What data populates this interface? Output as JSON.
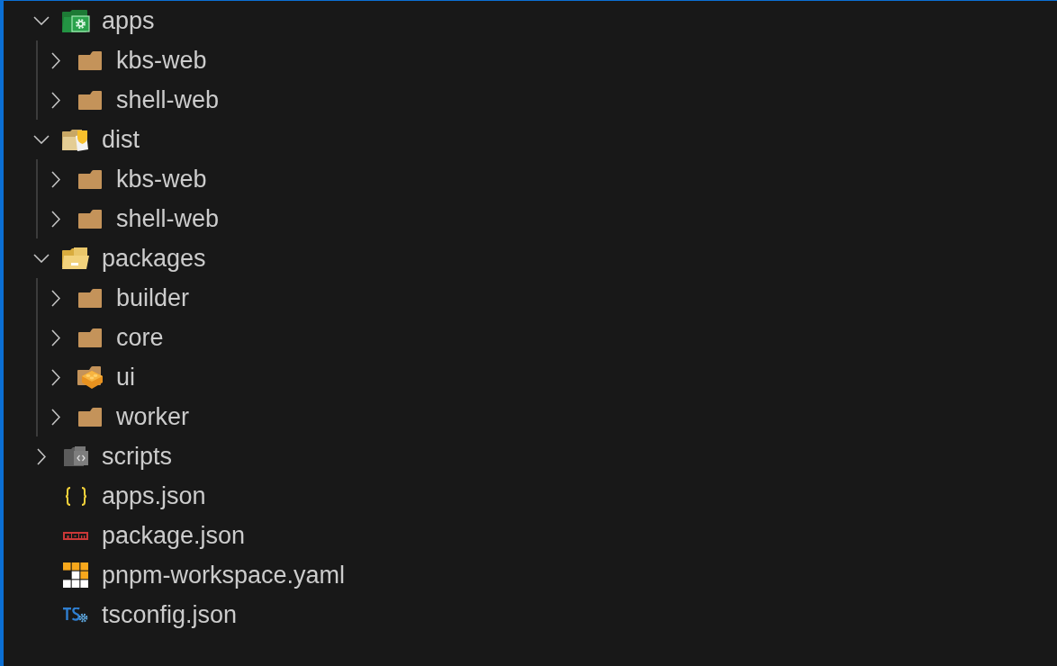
{
  "explorer": {
    "items": [
      {
        "name": "apps",
        "kind": "apps-folder",
        "expanded": true,
        "children": [
          {
            "name": "kbs-web",
            "kind": "folder",
            "expanded": false
          },
          {
            "name": "shell-web",
            "kind": "folder",
            "expanded": false
          }
        ]
      },
      {
        "name": "dist",
        "kind": "dist-folder",
        "expanded": true,
        "children": [
          {
            "name": "kbs-web",
            "kind": "folder",
            "expanded": false
          },
          {
            "name": "shell-web",
            "kind": "folder",
            "expanded": false
          }
        ]
      },
      {
        "name": "packages",
        "kind": "packages-folder",
        "expanded": true,
        "children": [
          {
            "name": "builder",
            "kind": "folder",
            "expanded": false
          },
          {
            "name": "core",
            "kind": "folder",
            "expanded": false
          },
          {
            "name": "ui",
            "kind": "brick-folder",
            "expanded": false
          },
          {
            "name": "worker",
            "kind": "folder",
            "expanded": false
          }
        ]
      },
      {
        "name": "scripts",
        "kind": "scripts-folder",
        "expanded": false
      },
      {
        "name": "apps.json",
        "kind": "json-file"
      },
      {
        "name": "package.json",
        "kind": "npm-file"
      },
      {
        "name": "pnpm-workspace.yaml",
        "kind": "pnpm-file"
      },
      {
        "name": "tsconfig.json",
        "kind": "tsconfig-file"
      }
    ]
  }
}
